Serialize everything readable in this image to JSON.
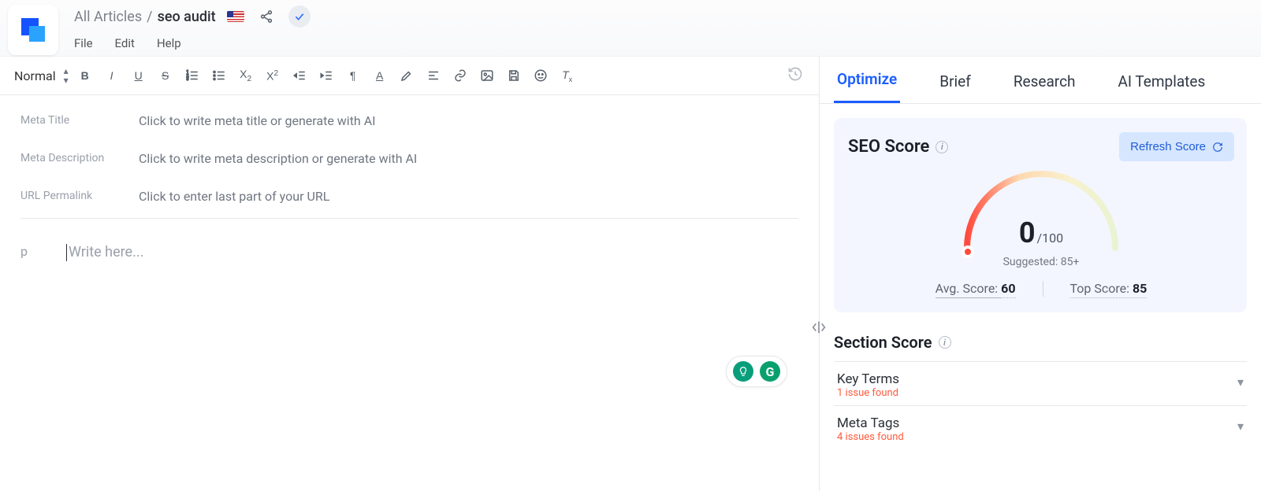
{
  "breadcrumb": {
    "root": "All Articles",
    "sep": "/",
    "current": "seo audit"
  },
  "menus": {
    "file": "File",
    "edit": "Edit",
    "help": "Help"
  },
  "toolbar": {
    "format_select": "Normal"
  },
  "meta": {
    "title_label": "Meta Title",
    "title_ph": "Click to write meta title or generate with AI",
    "desc_label": "Meta Description",
    "desc_ph": "Click to write meta description or generate with AI",
    "url_label": "URL Permalink",
    "url_ph": "Click to enter last part of your URL"
  },
  "editor": {
    "gutter": "p",
    "placeholder": "Write here..."
  },
  "panel": {
    "tabs": {
      "optimize": "Optimize",
      "brief": "Brief",
      "research": "Research",
      "ai": "AI Templates"
    },
    "seo": {
      "heading": "SEO Score",
      "refresh": "Refresh Score",
      "score": "0",
      "of": "/100",
      "suggest": "Suggested: 85+",
      "avg_label": "Avg. Score: ",
      "avg_val": "60",
      "top_label": "Top Score: ",
      "top_val": "85"
    },
    "section": {
      "heading": "Section Score",
      "items": [
        {
          "title": "Key Terms",
          "sub": "1 issue found"
        },
        {
          "title": "Meta Tags",
          "sub": "4 issues found"
        }
      ]
    }
  }
}
